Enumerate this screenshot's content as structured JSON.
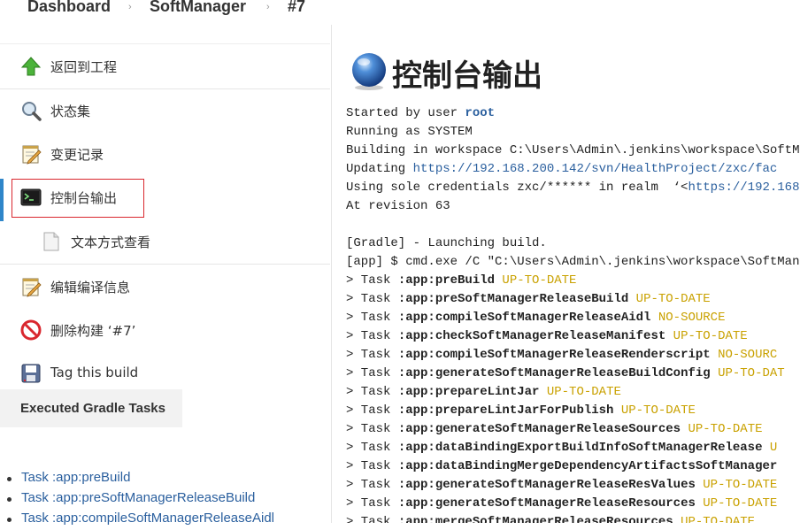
{
  "breadcrumb": {
    "items": [
      "Dashboard",
      "SoftManager",
      "#7"
    ],
    "separator": "›"
  },
  "sidebar": {
    "tasks": [
      {
        "label": "返回到工程",
        "icon": "up-arrow-icon"
      },
      {
        "label": "状态集",
        "icon": "magnifier-icon"
      },
      {
        "label": "变更记录",
        "icon": "notepad-icon"
      },
      {
        "label": "控制台输出",
        "icon": "terminal-icon",
        "active": true
      },
      {
        "label": "文本方式查看",
        "icon": "document-icon"
      },
      {
        "label": "编辑编译信息",
        "icon": "notepad-edit-icon"
      },
      {
        "label": "删除构建 ‘#7’",
        "icon": "no-entry-icon"
      },
      {
        "label": "Tag this build",
        "icon": "save-icon"
      }
    ]
  },
  "gradle": {
    "title": "Executed Gradle Tasks",
    "items": [
      "Task :app:preBuild",
      "Task :app:preSoftManagerReleaseBuild",
      "Task :app:compileSoftManagerReleaseAidl"
    ]
  },
  "main": {
    "title": "控制台输出",
    "console": [
      {
        "parts": [
          {
            "t": "Started by user "
          },
          {
            "t": "root",
            "k": "link bold"
          }
        ]
      },
      {
        "parts": [
          {
            "t": "Running as SYSTEM"
          }
        ]
      },
      {
        "parts": [
          {
            "t": "Building in workspace C:\\Users\\Admin\\.jenkins\\workspace\\SoftMana"
          }
        ]
      },
      {
        "parts": [
          {
            "t": "Updating "
          },
          {
            "t": "https://192.168.200.142/svn/HealthProject/zxc/fac",
            "k": "link"
          }
        ]
      },
      {
        "parts": [
          {
            "t": "Using sole credentials zxc/****** in realm  ‘<"
          },
          {
            "t": "https://192.168.",
            "k": "link"
          }
        ]
      },
      {
        "parts": [
          {
            "t": "At revision 63"
          }
        ]
      },
      {
        "parts": [
          {
            "t": ""
          }
        ]
      },
      {
        "parts": [
          {
            "t": "[Gradle] - Launching build."
          }
        ]
      },
      {
        "parts": [
          {
            "t": "[app] $ cmd.exe /C \"C:\\Users\\Admin\\.jenkins\\workspace\\SoftManager"
          }
        ]
      },
      {
        "parts": [
          {
            "t": "> Task "
          },
          {
            "t": ":app:preBuild",
            "k": "bold"
          },
          {
            "t": " UP-TO-DATE",
            "k": "status"
          }
        ]
      },
      {
        "parts": [
          {
            "t": "> Task "
          },
          {
            "t": ":app:preSoftManagerReleaseBuild",
            "k": "bold"
          },
          {
            "t": " UP-TO-DATE",
            "k": "status"
          }
        ]
      },
      {
        "parts": [
          {
            "t": "> Task "
          },
          {
            "t": ":app:compileSoftManagerReleaseAidl",
            "k": "bold"
          },
          {
            "t": " NO-SOURCE",
            "k": "status"
          }
        ]
      },
      {
        "parts": [
          {
            "t": "> Task "
          },
          {
            "t": ":app:checkSoftManagerReleaseManifest",
            "k": "bold"
          },
          {
            "t": " UP-TO-DATE",
            "k": "status"
          }
        ]
      },
      {
        "parts": [
          {
            "t": "> Task "
          },
          {
            "t": ":app:compileSoftManagerReleaseRenderscript",
            "k": "bold"
          },
          {
            "t": " NO-SOURC",
            "k": "status"
          }
        ]
      },
      {
        "parts": [
          {
            "t": "> Task "
          },
          {
            "t": ":app:generateSoftManagerReleaseBuildConfig",
            "k": "bold"
          },
          {
            "t": " UP-TO-DAT",
            "k": "status"
          }
        ]
      },
      {
        "parts": [
          {
            "t": "> Task "
          },
          {
            "t": ":app:prepareLintJar",
            "k": "bold"
          },
          {
            "t": " UP-TO-DATE",
            "k": "status"
          }
        ]
      },
      {
        "parts": [
          {
            "t": "> Task "
          },
          {
            "t": ":app:prepareLintJarForPublish",
            "k": "bold"
          },
          {
            "t": " UP-TO-DATE",
            "k": "status"
          }
        ]
      },
      {
        "parts": [
          {
            "t": "> Task "
          },
          {
            "t": ":app:generateSoftManagerReleaseSources",
            "k": "bold"
          },
          {
            "t": " UP-TO-DATE",
            "k": "status"
          }
        ]
      },
      {
        "parts": [
          {
            "t": "> Task "
          },
          {
            "t": ":app:dataBindingExportBuildInfoSoftManagerRelease",
            "k": "bold"
          },
          {
            "t": " U",
            "k": "status"
          }
        ]
      },
      {
        "parts": [
          {
            "t": "> Task "
          },
          {
            "t": ":app:dataBindingMergeDependencyArtifactsSoftManager",
            "k": "bold"
          }
        ]
      },
      {
        "parts": [
          {
            "t": "> Task "
          },
          {
            "t": ":app:generateSoftManagerReleaseResValues",
            "k": "bold"
          },
          {
            "t": " UP-TO-DATE",
            "k": "status"
          }
        ]
      },
      {
        "parts": [
          {
            "t": "> Task "
          },
          {
            "t": ":app:generateSoftManagerReleaseResources",
            "k": "bold"
          },
          {
            "t": " UP-TO-DATE",
            "k": "status"
          }
        ]
      },
      {
        "parts": [
          {
            "t": "> Task "
          },
          {
            "t": ":app:mergeSoftManagerReleaseResources",
            "k": "bold"
          },
          {
            "t": " UP-TO-DATE",
            "k": "status"
          }
        ]
      }
    ]
  },
  "colors": {
    "link": "#2a5f9e",
    "status": "#c9a100",
    "highlight": "#d9272e",
    "active_bar": "#2f86c9"
  }
}
